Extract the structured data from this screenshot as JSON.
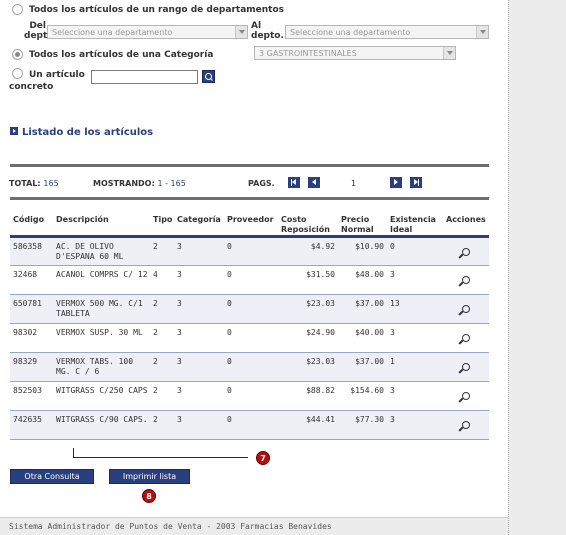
{
  "filters": {
    "range": {
      "label": "Todos los artículos de un rango de departamentos",
      "from_label": "Del depto.",
      "from_value": "Seleccione una departamento",
      "to_label": "Al depto.",
      "to_value": "Seleccione una departamento",
      "selected": false
    },
    "category": {
      "label": "Todos los artículos de una Categoría",
      "value": "3 GASTROINTESTINALES",
      "selected": true
    },
    "single": {
      "label": "Un artículo concreto",
      "value": "",
      "selected": false
    }
  },
  "section_title": "Listado de los artículos",
  "stats": {
    "total_label": "TOTAL:",
    "total_value": "165",
    "showing_label": "MOSTRANDO:",
    "showing_value": "1 - 165",
    "pages_label": "PAGS.",
    "current_page": "1"
  },
  "table": {
    "columns": [
      "Código",
      "Descripción",
      "Tipo",
      "Categoría",
      "Proveedor",
      "Costo Reposición",
      "Precio Normal",
      "Existencia Ideal",
      "Acciones"
    ],
    "rows": [
      [
        "586358",
        "AC. DE OLIVO D'ESPANA 60 ML",
        "2",
        "3",
        "0",
        "$4.92",
        "$10.90",
        "0"
      ],
      [
        "32468",
        "ACANOL COMPRS C/ 12",
        "4",
        "3",
        "0",
        "$31.50",
        "$48.00",
        "3"
      ],
      [
        "650781",
        "VERMOX 500 MG. C/1 TABLETA",
        "2",
        "3",
        "0",
        "$23.03",
        "$37.00",
        "13"
      ],
      [
        "98302",
        "VERMOX SUSP. 30 ML",
        "2",
        "3",
        "0",
        "$24.90",
        "$40.00",
        "3"
      ],
      [
        "98329",
        "VERMOX TABS. 100 MG. C / 6",
        "2",
        "3",
        "0",
        "$23.03",
        "$37.00",
        "1"
      ],
      [
        "852503",
        "WITGRASS C/250 CAPS",
        "2",
        "3",
        "0",
        "$88.82",
        "$154.60",
        "3"
      ],
      [
        "742635",
        "WITGRASS C/90 CAPS.",
        "2",
        "3",
        "0",
        "$44.41",
        "$77.30",
        "3"
      ]
    ]
  },
  "callouts": [
    "7",
    "8"
  ],
  "buttons": {
    "other_query": "Otra Consulta",
    "print_list": "Imprimir lista"
  },
  "footer": "Sistema Administrador de Puntos de Venta - 2003 Farmacias Benavides",
  "colors": {
    "accent": "#2a3f7e",
    "callout": "#b01010",
    "row_alt": "#eef0f5"
  }
}
